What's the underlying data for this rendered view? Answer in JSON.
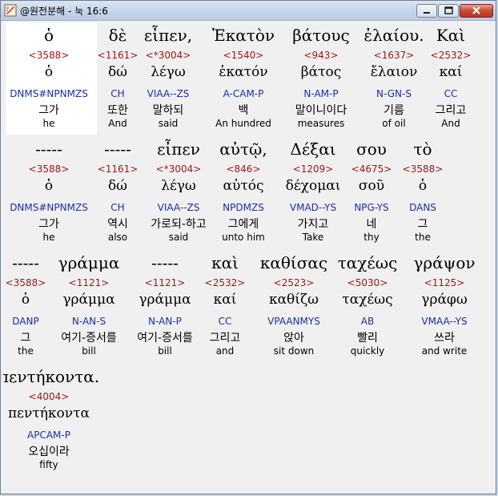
{
  "window": {
    "title": "@원전분해 - 눅 16:6"
  },
  "rows": [
    {
      "words": [
        {
          "greek": "ὁ",
          "strong": "<3588>",
          "lemma": "ὁ",
          "morph": "DNMS#NPNMZS",
          "korean": "그가",
          "english": "he"
        },
        {
          "greek": "δὲ",
          "strong": "<1161>",
          "lemma": "δώ",
          "morph": "CH",
          "korean": "또한",
          "english": "And"
        },
        {
          "greek": "εἶπεν,",
          "strong": "<*3004>",
          "lemma": "λέγω",
          "morph": "VIAA--ZS",
          "korean": "말하되",
          "english": "said"
        },
        {
          "greek": "Ἑκατὸν",
          "strong": "<1540>",
          "lemma": "ἑκατόν",
          "morph": "A-CAM-P",
          "korean": "백",
          "english": "An hundred"
        },
        {
          "greek": "βάτους",
          "strong": "<943>",
          "lemma": "βάτος",
          "morph": "N-AM-P",
          "korean": "말이니이다",
          "english": "measures"
        },
        {
          "greek": "ἐλαίου.",
          "strong": "<1637>",
          "lemma": "ἔλαιον",
          "morph": "N-GN-S",
          "korean": "기름",
          "english": "of oil"
        },
        {
          "greek": "Καὶ",
          "strong": "<2532>",
          "lemma": "καί",
          "morph": "CC",
          "korean": "그리고",
          "english": "And"
        }
      ]
    },
    {
      "words": [
        {
          "greek": "-----",
          "strong": "<3588>",
          "lemma": "ὁ",
          "morph": "DNMS#NPNMZS",
          "korean": "그가",
          "english": "he"
        },
        {
          "greek": "-----",
          "strong": "<1161>",
          "lemma": "δώ",
          "morph": "CH",
          "korean": "역시",
          "english": "also"
        },
        {
          "greek": "εἶπεν",
          "strong": "<*3004>",
          "lemma": "λέγω",
          "morph": "VIAA--ZS",
          "korean": "가로되-하고",
          "english": "said"
        },
        {
          "greek": "αὐτῷ,",
          "strong": "<846>",
          "lemma": "αὐτός",
          "morph": "NPDMZS",
          "korean": "그에게",
          "english": "unto him"
        },
        {
          "greek": "Δέξαι",
          "strong": "<1209>",
          "lemma": "δέχομαι",
          "morph": "VMAD--YS",
          "korean": "가지고",
          "english": "Take"
        },
        {
          "greek": "σου",
          "strong": "<4675>",
          "lemma": "σοῦ",
          "morph": "NPG-YS",
          "korean": "네",
          "english": "thy"
        },
        {
          "greek": "τὸ",
          "strong": "<3588>",
          "lemma": "ὁ",
          "morph": "DANS",
          "korean": "그",
          "english": "the"
        }
      ]
    },
    {
      "words": [
        {
          "greek": "-----",
          "strong": "<3588>",
          "lemma": "ὁ",
          "morph": "DANP",
          "korean": "그",
          "english": "the"
        },
        {
          "greek": "γράμμα",
          "strong": "<1121>",
          "lemma": "γράμμα",
          "morph": "N-AN-S",
          "korean": "여기-증서를",
          "english": "bill"
        },
        {
          "greek": "-----",
          "strong": "<1121>",
          "lemma": "γράμμα",
          "morph": "N-AN-P",
          "korean": "여기-증서를",
          "english": "bill"
        },
        {
          "greek": "καὶ",
          "strong": "<2532>",
          "lemma": "καί",
          "morph": "CC",
          "korean": "그리고",
          "english": "and"
        },
        {
          "greek": "καθίσας",
          "strong": "<2523>",
          "lemma": "καθίζω",
          "morph": "VPAANMYS",
          "korean": "앉아",
          "english": "sit down"
        },
        {
          "greek": "ταχέως",
          "strong": "<5030>",
          "lemma": "ταχέως",
          "morph": "AB",
          "korean": "빨리",
          "english": "quickly"
        },
        {
          "greek": "γράψον",
          "strong": "<1125>",
          "lemma": "γράφω",
          "morph": "VMAA--YS",
          "korean": "쓰라",
          "english": "and write"
        }
      ]
    },
    {
      "words": [
        {
          "greek": "πεντήκοντα.",
          "strong": "<4004>",
          "lemma": "πεντήκοντα",
          "morph": "APCAM-P",
          "korean": "오십이라",
          "english": "fifty"
        }
      ]
    }
  ],
  "colors": {
    "strong_number": "#a01818",
    "morphology": "#1a2ea8",
    "selection_bg": "#ffffff",
    "body_bg": "#f0f0f0"
  }
}
